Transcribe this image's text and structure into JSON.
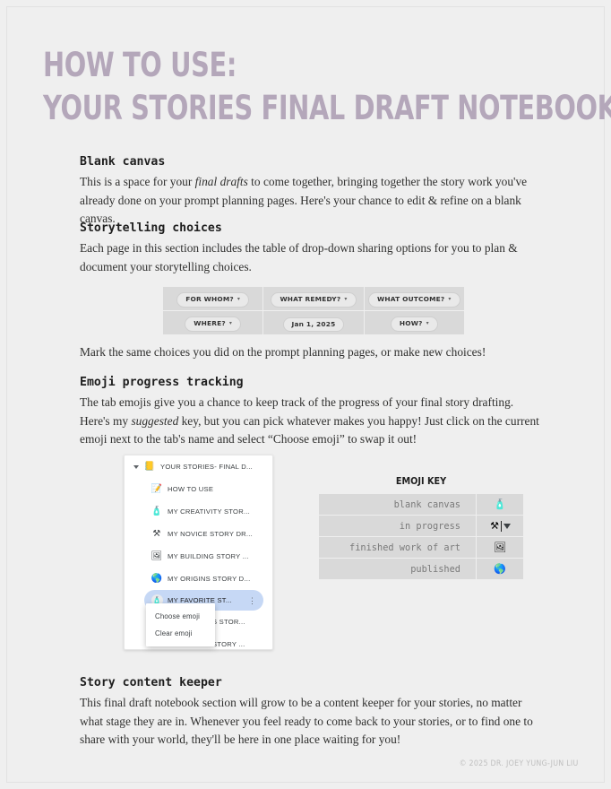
{
  "title": {
    "line1": "HOW TO USE:",
    "line2": "YOUR STORIES FINAL DRAFT NOTEBOOK",
    "color": "#b4a7ba"
  },
  "sections": {
    "blank_canvas": {
      "heading": "Blank canvas",
      "body_part1": "This is a space for your ",
      "body_italic": "final drafts",
      "body_part2": " to come together, bringing together the story work you've already done on your prompt planning pages. Here's your chance to edit & refine on a blank canvas."
    },
    "storytelling_choices": {
      "heading": "Storytelling choices",
      "body": "Each page in this section includes the table of drop-down sharing options for you to plan & document your storytelling choices."
    },
    "mark_note": "Mark the same choices you did on the prompt planning pages, or make new choices!",
    "emoji_tracking": {
      "heading": "Emoji progress tracking",
      "body_part1": "The tab emojis give you a chance to keep track of the progress of your final story drafting. Here's my ",
      "body_italic": "suggested",
      "body_part2": " key, but you can pick whatever makes you happy! Just click on the current emoji next to the tab's name and select “Choose emoji” to swap it out!"
    },
    "story_keeper": {
      "heading": "Story content keeper",
      "body": "This final draft notebook section will grow to be a content keeper for your stories, no matter what stage they are in. Whenever you feel ready to come back to your stories, or to find one to share with your world, they'll be here in one place waiting for you!"
    }
  },
  "choices_table": {
    "rows": [
      [
        {
          "label": "FOR WHOM?",
          "caret": "▾"
        },
        {
          "label": "WHAT REMEDY?",
          "caret": "▾"
        },
        {
          "label": "WHAT OUTCOME?",
          "caret": "▾"
        }
      ],
      [
        {
          "label": "WHERE?",
          "caret": "▾"
        },
        {
          "label": "Jan 1, 2025",
          "caret": ""
        },
        {
          "label": "HOW?",
          "caret": "▾"
        }
      ]
    ]
  },
  "tree_panel": {
    "root": {
      "label": "YOUR STORIES- FINAL D...",
      "icon": "📒"
    },
    "items": [
      {
        "label": "HOW TO USE",
        "icon": "📝",
        "selected": false
      },
      {
        "label": "MY CREATIVITY STOR...",
        "icon": "🧴",
        "selected": false
      },
      {
        "label": "MY NOVICE STORY DR...",
        "icon": "⚒",
        "selected": false
      },
      {
        "label": "MY BUILDING STORY ...",
        "icon": "🖼",
        "selected": false
      },
      {
        "label": "MY ORIGINS STORY D...",
        "icon": "🌎",
        "selected": false
      },
      {
        "label": "MY FAVORITE ST...",
        "icon": "🧴",
        "selected": true,
        "menu_dots": "⋮"
      },
      {
        "label": "S STOR...",
        "icon": "",
        "selected": false
      },
      {
        "label": "STORY ...",
        "icon": "",
        "selected": false
      }
    ],
    "context_menu": {
      "items": [
        "Choose emoji",
        "Clear emoji"
      ]
    }
  },
  "emoji_key": {
    "title": "EMOJI KEY",
    "rows": [
      {
        "label": "blank canvas",
        "emoji": "🧴",
        "editing": false
      },
      {
        "label": "in progress",
        "emoji": "⚒",
        "editing": true
      },
      {
        "label": "finished work of art",
        "emoji": "🖼",
        "editing": false
      },
      {
        "label": "published",
        "emoji": "🌎",
        "editing": false
      }
    ]
  },
  "footer": {
    "copyright": "© 2025 DR. JOEY YUNG-JUN LIU"
  }
}
